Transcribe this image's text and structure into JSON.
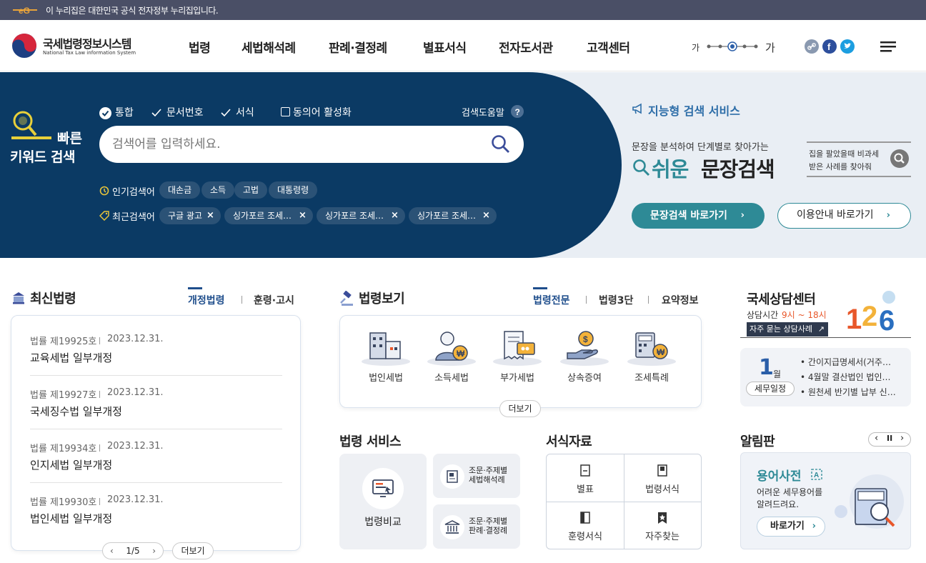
{
  "gov_banner": {
    "text": "이 누리집은 대한민국 공식 전자정부 누리집입니다."
  },
  "header": {
    "logo_title": "국세법령정보시스템",
    "logo_subtitle": "National Tax Law information System",
    "nav": [
      "법령",
      "세법해석례",
      "판례·결정례",
      "별표서식",
      "전자도서관",
      "고객센터"
    ],
    "font_small": "가",
    "font_large": "가"
  },
  "search": {
    "side_label_1": "빠른",
    "side_label_2": "키워드 검색",
    "options": [
      "통합",
      "문서번호",
      "서식"
    ],
    "synonym_label": "동의어 활성화",
    "help_label": "검색도움말",
    "placeholder": "검색어를 입력하세요.",
    "popular_label": "인기검색어",
    "popular": [
      "대손금",
      "소득",
      "고법",
      "대통령령"
    ],
    "recent_label": "최근검색어",
    "recent": [
      "구글 광고",
      "싱가포르 조세…",
      "싱가포르 조세…",
      "싱가포르 조세…"
    ]
  },
  "smart": {
    "title": "지능형 검색 서비스",
    "desc": "문장을 분석하여 단계별로 찾아가는",
    "big_1": "쉬운",
    "big_2": "문장검색",
    "example_1": "집을 팔았을때 비과세",
    "example_2": "받은 사례를 찾아줘",
    "btn_primary": "문장검색 바로가기",
    "btn_secondary": "이용안내 바로가기"
  },
  "latest": {
    "title": "최신법령",
    "tabs": [
      "개정법령",
      "훈령·고시"
    ],
    "items": [
      {
        "no": "법률 제19925호",
        "date": "2023.12.31.",
        "title": "교육세법 일부개정"
      },
      {
        "no": "법률 제19927호",
        "date": "2023.12.31.",
        "title": "국세징수법 일부개정"
      },
      {
        "no": "법률 제19934호",
        "date": "2023.12.31.",
        "title": "인지세법 일부개정"
      },
      {
        "no": "법률 제19930호",
        "date": "2023.12.31.",
        "title": "법인세법 일부개정"
      }
    ],
    "page": "1/5",
    "more": "더보기"
  },
  "lawview": {
    "title": "법령보기",
    "tabs": [
      "법령전문",
      "법령3단",
      "요약정보"
    ],
    "items": [
      "법인세법",
      "소득세법",
      "부가세법",
      "상속증여",
      "조세특례"
    ],
    "more": "더보기"
  },
  "center": {
    "title": "국세상담센터",
    "hours_label": "상담시간",
    "hours": "9시 ~ 18시",
    "faq": "자주 묻는 상담사례",
    "number": "126",
    "month": "1",
    "month_unit": "월",
    "schedule_label": "세무일정",
    "schedule": [
      "간이지급명세서(거주…",
      "4월말 결산법인 법인…",
      "원천세 반기별 납부 신…"
    ]
  },
  "lawservice": {
    "title": "법령 서비스",
    "main": "법령비교",
    "sub1_a": "조문·주제별",
    "sub1_b": "세법해석례",
    "sub2_a": "조문·주제별",
    "sub2_b": "판례·결정례"
  },
  "forms": {
    "title": "서식자료",
    "items": [
      "별표",
      "법령서식",
      "훈령서식",
      "자주찾는"
    ]
  },
  "notice": {
    "title": "알림판",
    "card_title": "용어사전",
    "desc_1": "어려운 세무용어를",
    "desc_2": "알려드려요.",
    "btn": "바로가기"
  },
  "colors": {
    "navy": "#0b3a64",
    "teal": "#2e8a96",
    "accent_orange": "#e8572a"
  }
}
